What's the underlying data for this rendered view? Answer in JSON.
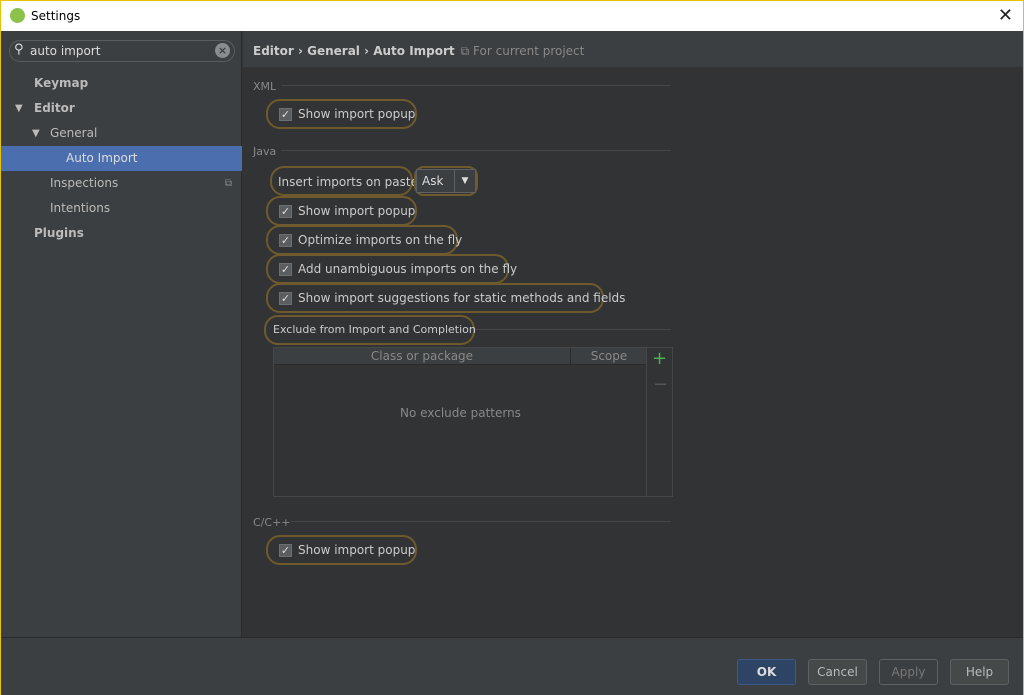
{
  "window": {
    "title": "Settings"
  },
  "search": {
    "value": "auto import"
  },
  "sidebar": {
    "items": [
      {
        "label": "Keymap"
      },
      {
        "label": "Editor"
      },
      {
        "label": "General"
      },
      {
        "label": "Auto Import"
      },
      {
        "label": "Inspections"
      },
      {
        "label": "Intentions"
      },
      {
        "label": "Plugins"
      }
    ]
  },
  "header": {
    "breadcrumb": "Editor › General › Auto Import",
    "scope": "For current project"
  },
  "xml": {
    "title": "XML",
    "show_popup": "Show import popup"
  },
  "java": {
    "title": "Java",
    "insert_label": "Insert imports on paste:",
    "insert_value": "Ask",
    "options": [
      "Show import popup",
      "Optimize imports on the fly",
      "Add unambiguous imports on the fly",
      "Show import suggestions for static methods and fields"
    ],
    "exclude_title": "Exclude from Import and Completion",
    "columns": [
      "Class or package",
      "Scope"
    ],
    "empty": "No exclude patterns"
  },
  "cpp": {
    "title": "C/C++",
    "show_popup": "Show import popup"
  },
  "footer": {
    "ok": "OK",
    "cancel": "Cancel",
    "apply": "Apply",
    "help": "Help"
  },
  "colors": {
    "accent": "#4b6eaf",
    "highlight": "#6e5a2c"
  }
}
